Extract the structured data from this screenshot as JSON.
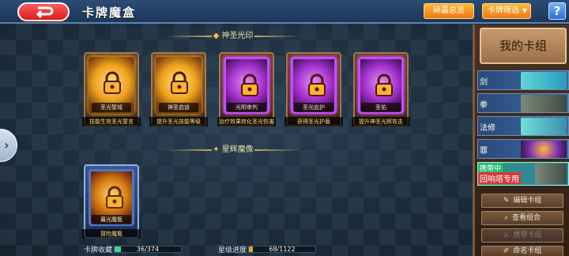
{
  "header": {
    "title": "卡牌魔盒",
    "tab1_label": "碎晶总览",
    "tab2_label": "卡牌筛选",
    "help_label": "?"
  },
  "sections": {
    "holy": "神圣光印",
    "star": "星辉魔像"
  },
  "cards": [
    {
      "name": "圣光誓域",
      "desc": "技能生效圣光誓言",
      "rarity": "gold"
    },
    {
      "name": "神圣启迪",
      "desc": "提升圣光技能等级",
      "rarity": "gold"
    },
    {
      "name": "光明审判",
      "desc": "治疗效果转化圣光伤害",
      "rarity": "purple"
    },
    {
      "name": "圣光庇护",
      "desc": "获得圣光护盾",
      "rarity": "purple"
    },
    {
      "name": "圣佑",
      "desc": "提升神圣光辉攻击",
      "rarity": "purple"
    }
  ],
  "star_cards": [
    {
      "name": "暮光魔瓶",
      "desc": "冒险魔瓶",
      "rarity": "blue"
    }
  ],
  "progress": {
    "collect_label": "卡牌收藏",
    "collect_value": "36/374",
    "collect_fraction": 0.096,
    "star_label": "星级进度",
    "star_value": "68/1122",
    "star_fraction": 0.061
  },
  "panel": {
    "title": "我的卡组",
    "decks": [
      {
        "label": "剑"
      },
      {
        "label": "拳"
      },
      {
        "label": "法修"
      },
      {
        "label": "罪"
      }
    ],
    "active_deck": {
      "tag": "携带中",
      "label": "回响塔专用"
    },
    "buttons": {
      "edit": "编辑卡组",
      "view": "查看组合",
      "carry": "携带卡组",
      "name": "命名卡组"
    }
  },
  "colors": {
    "accent_orange": "#f07a10",
    "collect_bar": "#3fd68a",
    "star_bar": "#f0a21f"
  }
}
